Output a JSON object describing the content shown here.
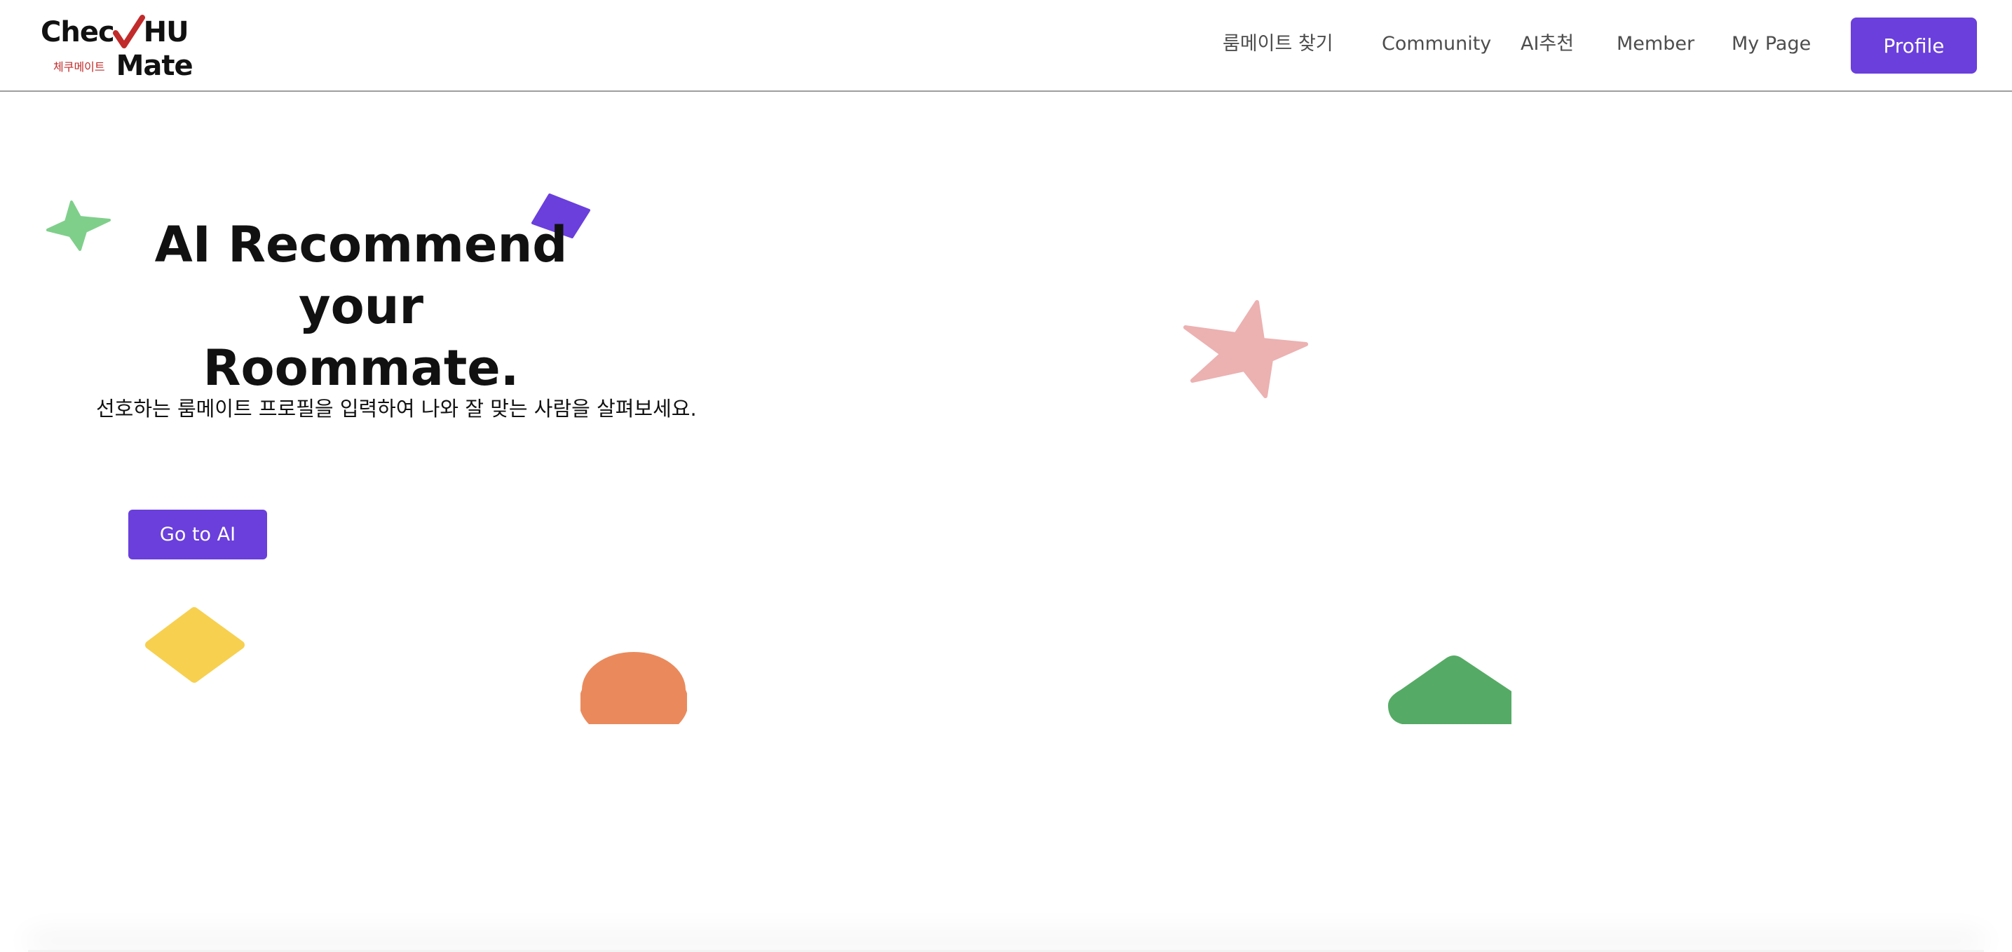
{
  "logo": {
    "text_top": "Chec",
    "text_top_end": "HU",
    "subtitle": "체쿠메이트",
    "text_bottom": "Mate"
  },
  "nav": {
    "items": [
      {
        "label": "룸메이트 찾기"
      },
      {
        "label": "Community"
      },
      {
        "label": "AI추천"
      },
      {
        "label": "Member"
      },
      {
        "label": "My Page"
      }
    ],
    "profile_label": "Profile"
  },
  "hero": {
    "title_line1": "AI Recommend",
    "title_line2": "your Roommate.",
    "subtitle": "선호하는 룸메이트 프로필을 입력하여 나와 잘 맞는 사람을 살펴보세요.",
    "cta_label": "Go to AI"
  },
  "colors": {
    "accent": "#6a3fdc",
    "logo_check": "#c12b2b",
    "deco_green_light": "#7fcf8b",
    "deco_purple": "#6a3fdc",
    "deco_pink": "#ecb1b1",
    "deco_yellow": "#f7d04f",
    "deco_orange": "#ea8a5c",
    "deco_green": "#55ab65"
  },
  "decorations": [
    "star-shape",
    "diamond-shape",
    "star-shape",
    "diamond-shape",
    "circle-shape",
    "triangle-shape"
  ]
}
